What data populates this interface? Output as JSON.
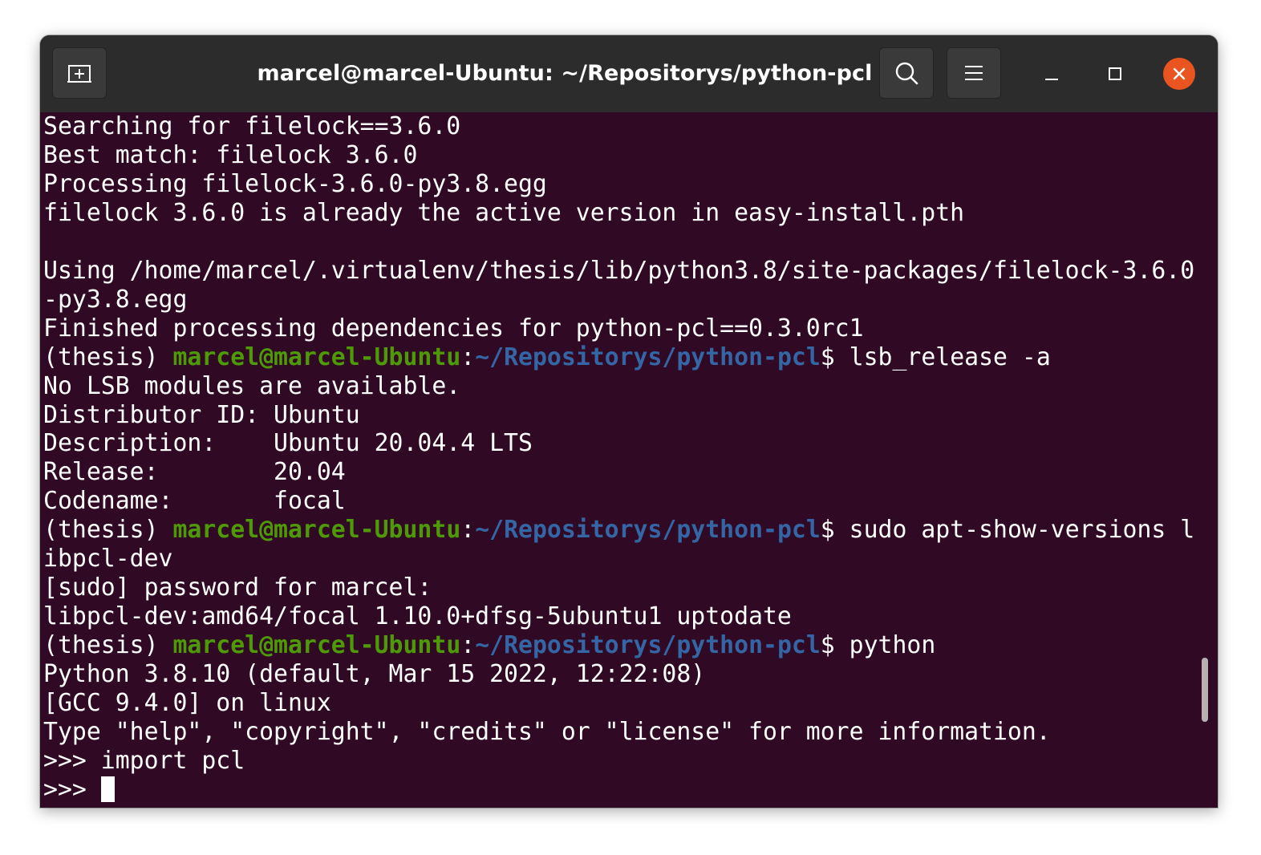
{
  "window": {
    "title": "marcel@marcel-Ubuntu: ~/Repositorys/python-pcl",
    "buttons": {
      "new_tab_icon": "new-tab-icon",
      "search_icon": "search-icon",
      "menu_icon": "hamburger-menu-icon",
      "minimize_icon": "minimize-icon",
      "maximize_icon": "maximize-icon",
      "close_icon": "close-icon"
    },
    "colors": {
      "terminal_bg": "#300a24",
      "titlebar_bg": "#2c2c2c",
      "prompt_user": "#4e9a06",
      "prompt_path": "#3465a4",
      "close": "#e95420"
    }
  },
  "terminal": {
    "lines": [
      {
        "text": "Searching for filelock==3.6.0"
      },
      {
        "text": "Best match: filelock 3.6.0"
      },
      {
        "text": "Processing filelock-3.6.0-py3.8.egg"
      },
      {
        "text": "filelock 3.6.0 is already the active version in easy-install.pth"
      },
      {
        "text": ""
      },
      {
        "text": "Using /home/marcel/.virtualenv/thesis/lib/python3.8/site-packages/filelock-3.6.0"
      },
      {
        "text": "-py3.8.egg"
      },
      {
        "text": "Finished processing dependencies for python-pcl==0.3.0rc1"
      },
      {
        "prompt": {
          "env": "(thesis) ",
          "user": "marcel@marcel-Ubuntu",
          "sep": ":",
          "path": "~/Repositorys/python-pcl",
          "dollar": "$ ",
          "cmd": "lsb_release -a"
        }
      },
      {
        "text": "No LSB modules are available."
      },
      {
        "text": "Distributor ID:\tUbuntu"
      },
      {
        "text": "Description:\tUbuntu 20.04.4 LTS"
      },
      {
        "text": "Release:\t20.04"
      },
      {
        "text": "Codename:\tfocal"
      },
      {
        "prompt": {
          "env": "(thesis) ",
          "user": "marcel@marcel-Ubuntu",
          "sep": ":",
          "path": "~/Repositorys/python-pcl",
          "dollar": "$ ",
          "cmd": "sudo apt-show-versions l"
        }
      },
      {
        "text": "ibpcl-dev"
      },
      {
        "text": "[sudo] password for marcel:"
      },
      {
        "text": "libpcl-dev:amd64/focal 1.10.0+dfsg-5ubuntu1 uptodate"
      },
      {
        "prompt": {
          "env": "(thesis) ",
          "user": "marcel@marcel-Ubuntu",
          "sep": ":",
          "path": "~/Repositorys/python-pcl",
          "dollar": "$ ",
          "cmd": "python"
        }
      },
      {
        "text": "Python 3.8.10 (default, Mar 15 2022, 12:22:08)"
      },
      {
        "text": "[GCC 9.4.0] on linux"
      },
      {
        "text": "Type \"help\", \"copyright\", \"credits\" or \"license\" for more information."
      },
      {
        "text": ">>> import pcl"
      },
      {
        "text": ">>> ",
        "cursor": true
      }
    ]
  }
}
